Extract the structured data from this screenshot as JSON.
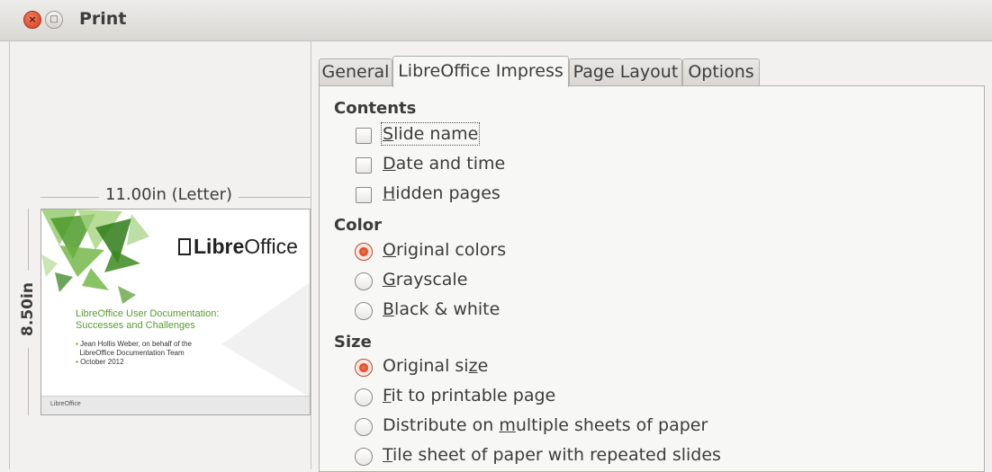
{
  "window": {
    "title": "Print"
  },
  "preview": {
    "width_label": "11.00in (Letter)",
    "height_label": "8.50in",
    "logo_pre": "Libre",
    "logo_post": "Office",
    "slide_title_line1": "LibreOffice User Documentation:",
    "slide_title_line2": "Successes and Challenges",
    "bullet1_line1": "Jean Hollis Weber, on behalf of the",
    "bullet1_line2": "LibreOffice Documentation Team",
    "bullet2": "October 2012",
    "footer_text": "LibreOffice"
  },
  "tabs": [
    {
      "label": "General"
    },
    {
      "label": "LibreOffice Impress"
    },
    {
      "label": "Page Layout"
    },
    {
      "label": "Options"
    }
  ],
  "contents": {
    "heading": "Contents",
    "slide_name": {
      "pre": "",
      "key": "S",
      "post": "lide name",
      "checked": false
    },
    "date_time": {
      "pre": "",
      "key": "D",
      "post": "ate and time",
      "checked": false
    },
    "hidden_pages": {
      "pre": "",
      "key": "H",
      "post": "idden pages",
      "checked": false
    }
  },
  "color": {
    "heading": "Color",
    "original": {
      "pre": "",
      "key": "O",
      "post": "riginal colors",
      "selected": true
    },
    "grayscale": {
      "pre": "",
      "key": "G",
      "post": "rayscale",
      "selected": false
    },
    "bw": {
      "pre": "",
      "key": "B",
      "post": "lack & white",
      "selected": false
    }
  },
  "size": {
    "heading": "Size",
    "original": {
      "pre": "Original si",
      "key": "z",
      "post": "e",
      "selected": true
    },
    "fit": {
      "pre": "",
      "key": "F",
      "post": "it to printable page",
      "selected": false
    },
    "distribute": {
      "pre": "Distribute on ",
      "key": "m",
      "post": "ultiple sheets of paper",
      "selected": false
    },
    "tile": {
      "pre": "",
      "key": "T",
      "post": "ile sheet of paper with repeated slides",
      "selected": false
    }
  },
  "colors": {
    "radio_accent": "#df4b24",
    "preview_green": "#5a9a2e"
  }
}
